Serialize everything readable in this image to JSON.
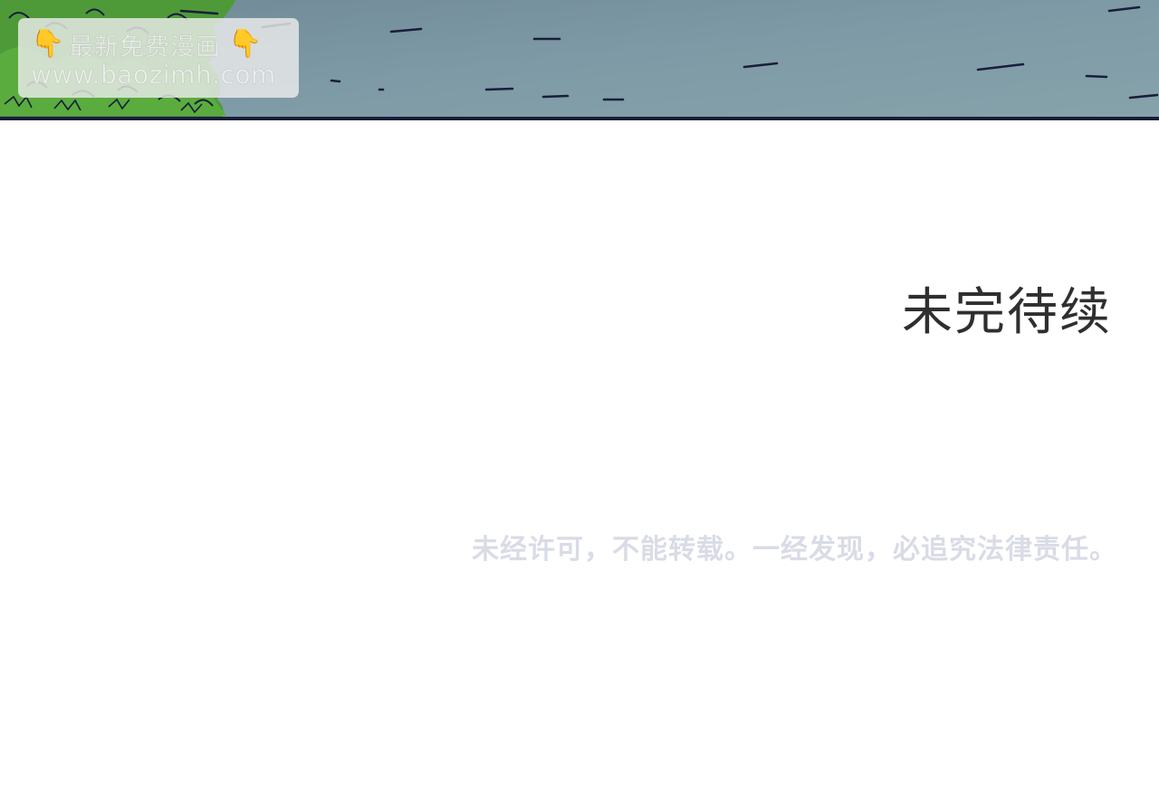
{
  "panel": {
    "sky_color": "#7b98a4",
    "foliage_color": "#4f9a3a",
    "ink_color": "#1a1d3a"
  },
  "watermark": {
    "hand_icon": "pointing-down-hand-icon",
    "title": "最新免费漫画",
    "url": "www.baozimh.com",
    "hand_glyph": "👇"
  },
  "caption": {
    "to_be_continued": "未完待续",
    "copyright_notice": "未经许可，不能转载。一经发现，必追究法律责任。"
  }
}
